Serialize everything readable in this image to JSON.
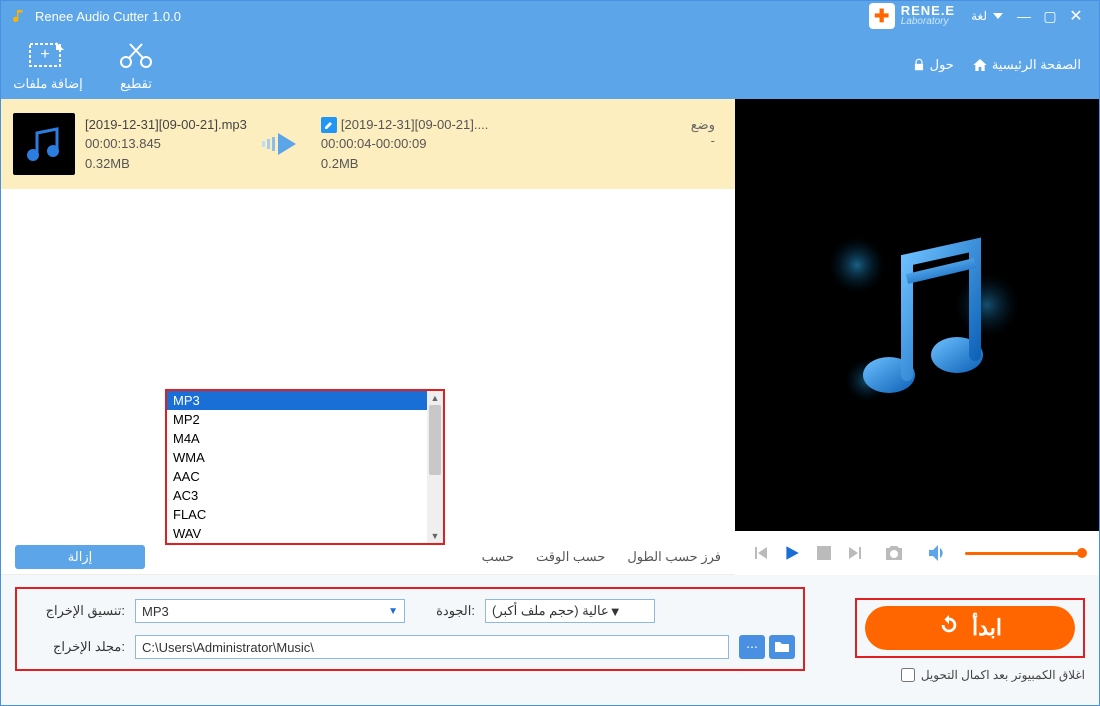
{
  "app": {
    "title": "Renee Audio Cutter 1.0.0"
  },
  "logo": {
    "brand": "RENE.E",
    "sub": "Laboratory"
  },
  "titlebar": {
    "lang_label": "لغة"
  },
  "toolbar": {
    "add_files_label": "إضافة ملفات",
    "cut_label": "تقطيع",
    "home_label": "الصفحة الرئيسية",
    "about_label": "حول"
  },
  "file": {
    "name": "[2019-12-31][09-00-21].mp3",
    "duration": "00:00:13.845",
    "size": "0.32MB",
    "out_name": "[2019-12-31][09-00-21]....",
    "out_range": "00:00:04-00:00:09",
    "out_size": "0.2MB",
    "status_label": "وضع",
    "status_value": "-"
  },
  "sort": {
    "group_label": "فرز حسب الطول",
    "by_time": "حسب الوقت",
    "by": "حسب",
    "remove_label": "إزالة"
  },
  "formats": {
    "list": [
      "MP3",
      "MP2",
      "M4A",
      "WMA",
      "AAC",
      "AC3",
      "FLAC",
      "WAV"
    ],
    "selected": "MP3"
  },
  "settings": {
    "format_label": "تنسيق الإخراج:",
    "format_value": "MP3",
    "quality_label": "الجودة:",
    "quality_value": "عالية (حجم ملف أكبر)",
    "folder_label": "مجلد الإخراج:",
    "folder_value": "C:\\Users\\Administrator\\Music\\"
  },
  "start": {
    "label": "ابدأ"
  },
  "shutdown": {
    "label": "اغلاق الكمبيوتر بعد اكمال التحويل"
  }
}
